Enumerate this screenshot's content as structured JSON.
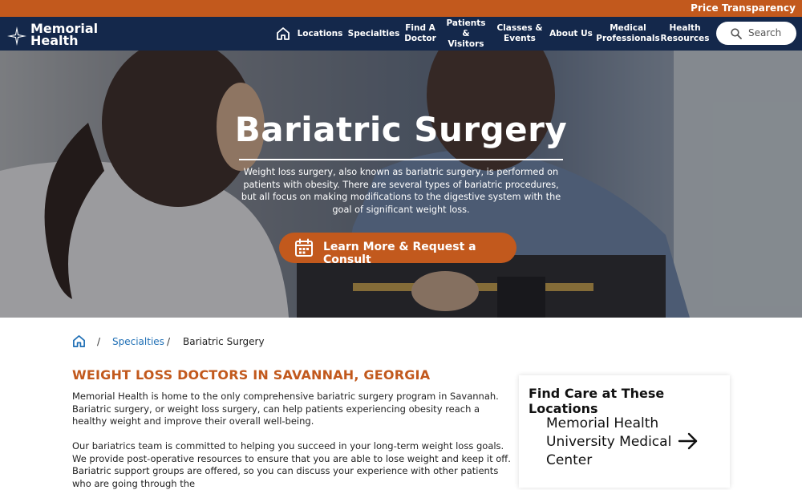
{
  "utility": {
    "link": "Price Transparency"
  },
  "logo": {
    "line1": "Memorial",
    "line2": "Health"
  },
  "nav": {
    "items": [
      {
        "label": "Locations"
      },
      {
        "label": "Specialties"
      },
      {
        "label": "Find A\nDoctor"
      },
      {
        "label": "Patients &\nVisitors"
      },
      {
        "label": "Classes &\nEvents"
      },
      {
        "label": "About Us"
      },
      {
        "label": "Medical\nProfessionals"
      },
      {
        "label": "Health\nResources"
      }
    ],
    "search_label": "Search"
  },
  "hero": {
    "title": "Bariatric Surgery",
    "description": "Weight loss surgery, also known as bariatric surgery, is performed on patients with obesity. There are several types of bariatric procedures, but all focus on making modifications to the digestive system with the goal of significant weight loss.",
    "cta": "Learn More & Request a Consult"
  },
  "breadcrumb": {
    "sep": "/",
    "link": "Specialties",
    "current": "Bariatric Surgery"
  },
  "content": {
    "heading": "WEIGHT LOSS DOCTORS IN SAVANNAH, GEORGIA",
    "para1": "Memorial Health is home to the only comprehensive bariatric surgery program in Savannah. Bariatric surgery, or weight loss surgery, can help patients experiencing obesity reach a healthy weight and improve their overall well-being.",
    "para2": "Our bariatrics team is committed to helping you succeed in your long-term weight loss goals. We provide post-operative resources to ensure that you are able to lose weight and keep it off. Bariatric support groups are offered, so you can discuss your experience with other patients who are going through the"
  },
  "card": {
    "title": "Find Care at These Locations",
    "location": "Memorial Health University Medical Center"
  },
  "colors": {
    "accent": "#c2591d",
    "navy": "#14284b",
    "link": "#1f6fb5"
  }
}
